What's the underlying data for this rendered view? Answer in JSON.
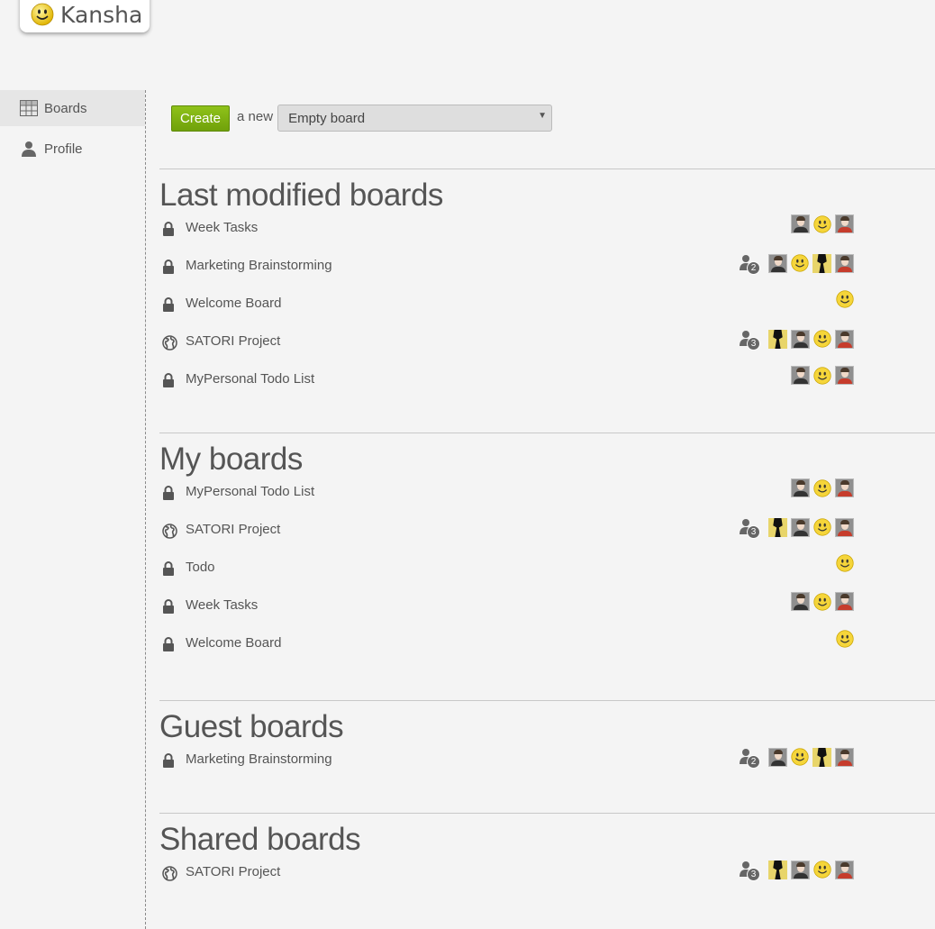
{
  "app": {
    "name": "Kansha"
  },
  "sidebar": {
    "items": [
      {
        "label": "Boards",
        "icon": "grid-icon",
        "active": true
      },
      {
        "label": "Profile",
        "icon": "user-icon",
        "active": false
      }
    ]
  },
  "create": {
    "button_label": "Create",
    "connector_text": "a new",
    "template_selected": "Empty board"
  },
  "sections": [
    {
      "title": "Last modified boards",
      "boards": [
        {
          "name": "Week Tasks",
          "visibility": "private",
          "guest_count": null,
          "members": [
            "person",
            "smiley",
            "person-dark"
          ]
        },
        {
          "name": "Marketing Brainstorming",
          "visibility": "private",
          "guest_count": "2",
          "members": [
            "person",
            "smiley",
            "silhouette",
            "person-dark"
          ]
        },
        {
          "name": "Welcome Board",
          "visibility": "private",
          "guest_count": null,
          "members": [
            "smiley"
          ]
        },
        {
          "name": "SATORI Project",
          "visibility": "public",
          "guest_count": "3",
          "members": [
            "silhouette",
            "person",
            "smiley",
            "person-dark"
          ]
        },
        {
          "name": "MyPersonal Todo List",
          "visibility": "private",
          "guest_count": null,
          "members": [
            "person",
            "smiley",
            "person-dark"
          ]
        }
      ]
    },
    {
      "title": "My boards",
      "boards": [
        {
          "name": "MyPersonal Todo List",
          "visibility": "private",
          "guest_count": null,
          "members": [
            "person",
            "smiley",
            "person-dark"
          ]
        },
        {
          "name": "SATORI Project",
          "visibility": "public",
          "guest_count": "3",
          "members": [
            "silhouette",
            "person",
            "smiley",
            "person-dark"
          ]
        },
        {
          "name": "Todo",
          "visibility": "private",
          "guest_count": null,
          "members": [
            "smiley"
          ]
        },
        {
          "name": "Week Tasks",
          "visibility": "private",
          "guest_count": null,
          "members": [
            "person",
            "smiley",
            "person-dark"
          ]
        },
        {
          "name": "Welcome Board",
          "visibility": "private",
          "guest_count": null,
          "members": [
            "smiley"
          ]
        }
      ]
    },
    {
      "title": "Guest boards",
      "boards": [
        {
          "name": "Marketing Brainstorming",
          "visibility": "private",
          "guest_count": "2",
          "members": [
            "person",
            "smiley",
            "silhouette",
            "person-dark"
          ]
        }
      ]
    },
    {
      "title": "Shared boards",
      "boards": [
        {
          "name": "SATORI Project",
          "visibility": "public",
          "guest_count": "3",
          "members": [
            "silhouette",
            "person",
            "smiley",
            "person-dark"
          ]
        }
      ]
    }
  ],
  "colors": {
    "accent_green": "#7cb211",
    "background": "#f4f4f4",
    "text": "#555555"
  }
}
